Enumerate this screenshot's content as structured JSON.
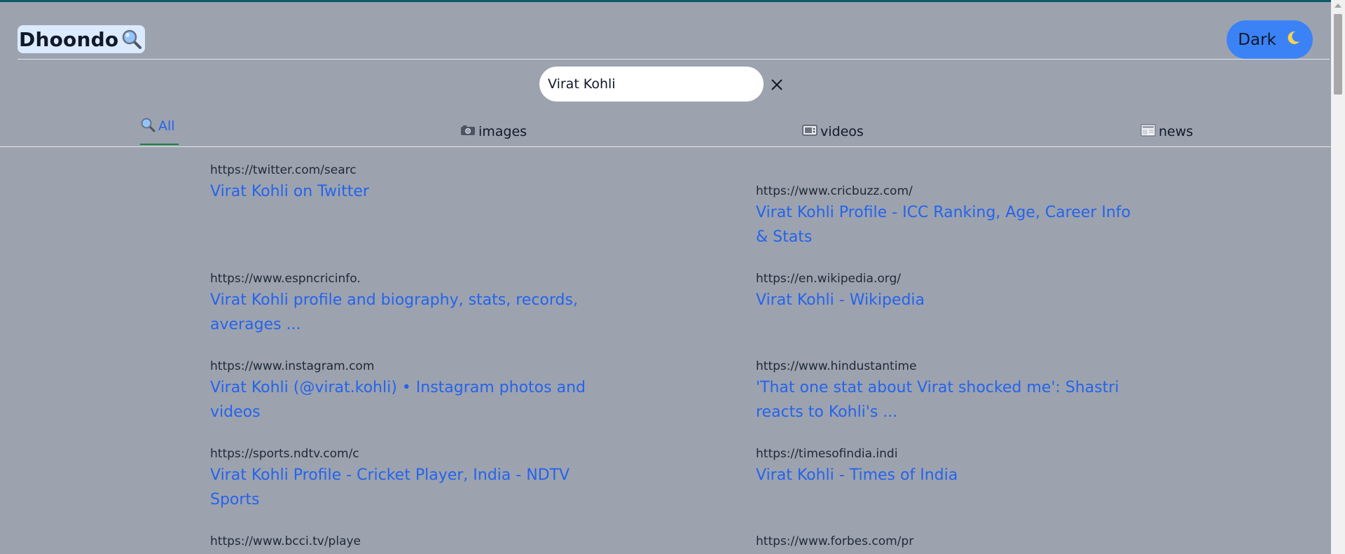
{
  "header": {
    "logo_text": "Dhoondo",
    "logo_icon": "magnifier-icon",
    "theme_button_label": "Dark",
    "theme_button_icon": "moon-icon",
    "accent_color": "#3b82f6"
  },
  "search": {
    "value": "Virat Kohli",
    "placeholder": ""
  },
  "tabs": [
    {
      "label": "All",
      "icon": "magnifier-icon",
      "active": true
    },
    {
      "label": "images",
      "icon": "camera-icon",
      "active": false
    },
    {
      "label": "videos",
      "icon": "tv-icon",
      "active": false
    },
    {
      "label": "news",
      "icon": "newspaper-icon",
      "active": false
    }
  ],
  "results": [
    {
      "url": "https://twitter.com/searc",
      "title": "Virat Kohli on Twitter"
    },
    {
      "url": "https://www.cricbuzz.com/",
      "title": "Virat Kohli Profile - ICC Ranking, Age, Career Info & Stats"
    },
    {
      "url": "https://www.espncricinfo.",
      "title": "Virat Kohli profile and biography, stats, records, averages ..."
    },
    {
      "url": "https://en.wikipedia.org/",
      "title": "Virat Kohli - Wikipedia"
    },
    {
      "url": "https://www.instagram.com",
      "title": "Virat Kohli (@virat.kohli) • Instagram photos and videos"
    },
    {
      "url": "https://www.hindustantime",
      "title": "'That one stat about Virat shocked me': Shastri reacts to Kohli's ..."
    },
    {
      "url": "https://sports.ndtv.com/c",
      "title": "Virat Kohli Profile - Cricket Player, India - NDTV Sports"
    },
    {
      "url": "https://timesofindia.indi",
      "title": "Virat Kohli - Times of India"
    },
    {
      "url": "https://www.bcci.tv/playe",
      "title": ""
    },
    {
      "url": "https://www.forbes.com/pr",
      "title": ""
    }
  ]
}
